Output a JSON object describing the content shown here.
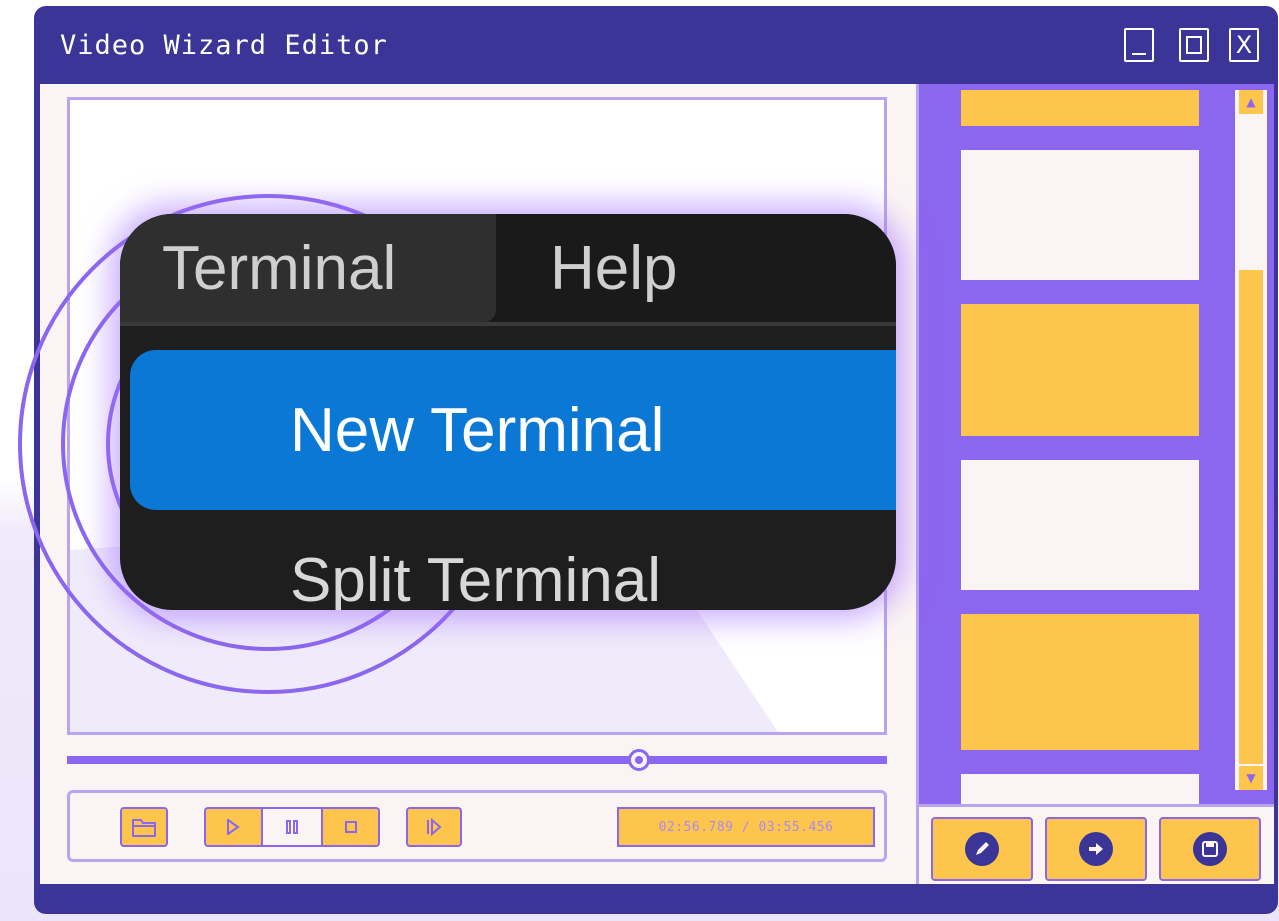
{
  "window": {
    "title": "Video Wizard Editor",
    "controls": [
      "minimize",
      "maximize",
      "close"
    ],
    "close_glyph": "X"
  },
  "player": {
    "timecode": "02:56.789 / 03:55.456",
    "progress": 0.66,
    "buttons": {
      "open": "folder-icon",
      "play": "play-icon",
      "pause": "pause-icon",
      "stop": "stop-icon",
      "next": "next-frame-icon"
    }
  },
  "sidebar": {
    "thumbnails": [
      "yellow",
      "white",
      "yellow",
      "white",
      "yellow",
      "white"
    ],
    "actions": [
      "edit-icon",
      "forward-icon",
      "save-icon"
    ]
  },
  "callout": {
    "menu_items": [
      "Terminal",
      "Help"
    ],
    "highlighted_item": "New Terminal",
    "next_item": "Split Terminal"
  },
  "colors": {
    "frame": "#3a3596",
    "accent": "#8b66ee",
    "yellow": "#fdc54c",
    "panel": "#fbf4f4",
    "highlight": "#0a78d4"
  }
}
